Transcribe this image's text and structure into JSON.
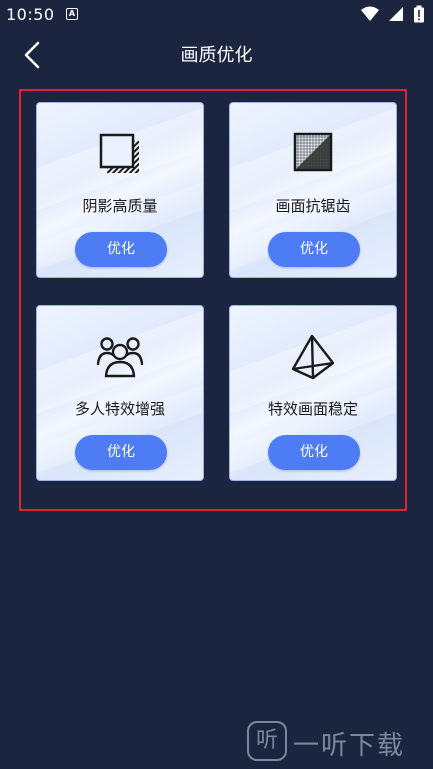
{
  "status_bar": {
    "time": "10:50",
    "notification_glyph": "A",
    "icons": [
      "wifi-icon",
      "signal-icon",
      "battery-icon"
    ]
  },
  "header": {
    "title": "画质优化",
    "back_icon": "chevron-left-icon"
  },
  "cards": [
    {
      "label": "阴影高质量",
      "button": "优化",
      "icon": "shadow-squares-icon"
    },
    {
      "label": "画面抗锯齿",
      "button": "优化",
      "icon": "antialias-grid-icon"
    },
    {
      "label": "多人特效增强",
      "button": "优化",
      "icon": "users-group-icon"
    },
    {
      "label": "特效画面稳定",
      "button": "优化",
      "icon": "pyramid-icon"
    }
  ],
  "watermark": {
    "text": "一听下载",
    "glyph": "听"
  },
  "colors": {
    "background": "#1b2540",
    "button": "#4e7cf4",
    "highlight_frame": "#e2232b"
  }
}
